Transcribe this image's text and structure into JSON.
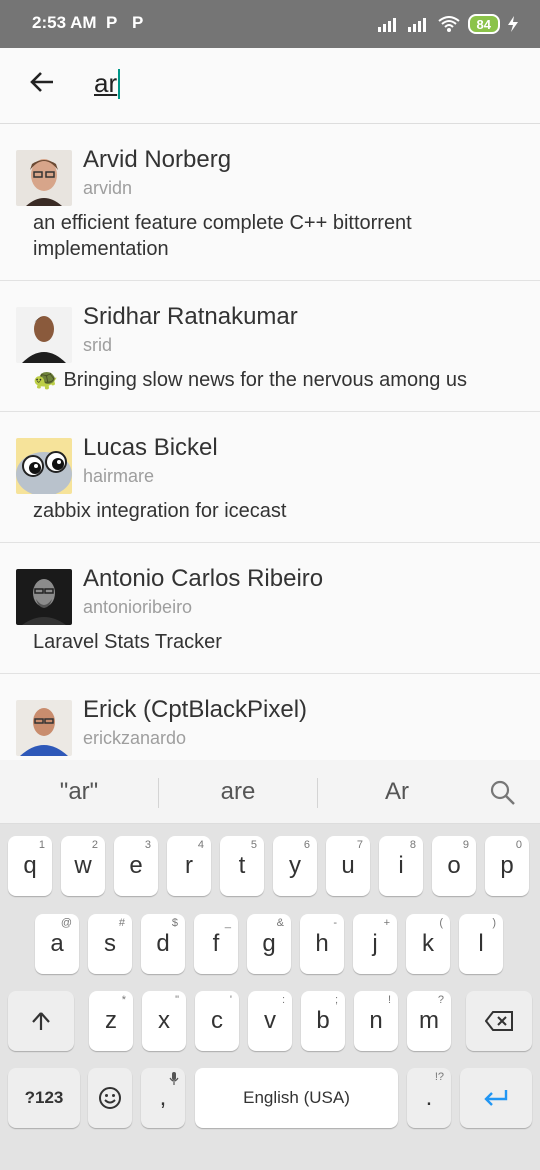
{
  "status": {
    "time": "2:53 AM",
    "p1": "P",
    "p2": "P",
    "battery": "84"
  },
  "search": {
    "query": "ar"
  },
  "results": [
    {
      "name": "Arvid Norberg",
      "login": "arvidn",
      "description": "an efficient feature complete C++ bittorrent implementation",
      "emoji": ""
    },
    {
      "name": "Sridhar Ratnakumar",
      "login": "srid",
      "description": "Bringing slow news for the nervous among us",
      "emoji": "🐢"
    },
    {
      "name": "Lucas Bickel",
      "login": "hairmare",
      "description": "zabbix integration for icecast",
      "emoji": ""
    },
    {
      "name": "Antonio Carlos Ribeiro",
      "login": "antonioribeiro",
      "description": "Laravel Stats Tracker",
      "emoji": ""
    },
    {
      "name": "Erick (CptBlackPixel)",
      "login": "erickzanardo",
      "description": "",
      "emoji": ""
    }
  ],
  "suggestions": [
    "\"ar\"",
    "are",
    "Ar"
  ],
  "keyboard": {
    "row1": [
      {
        "k": "q",
        "h": "1"
      },
      {
        "k": "w",
        "h": "2"
      },
      {
        "k": "e",
        "h": "3"
      },
      {
        "k": "r",
        "h": "4"
      },
      {
        "k": "t",
        "h": "5"
      },
      {
        "k": "y",
        "h": "6"
      },
      {
        "k": "u",
        "h": "7"
      },
      {
        "k": "i",
        "h": "8"
      },
      {
        "k": "o",
        "h": "9"
      },
      {
        "k": "p",
        "h": "0"
      }
    ],
    "row2": [
      {
        "k": "a",
        "h": "@"
      },
      {
        "k": "s",
        "h": "#"
      },
      {
        "k": "d",
        "h": "$"
      },
      {
        "k": "f",
        "h": "_"
      },
      {
        "k": "g",
        "h": "&"
      },
      {
        "k": "h",
        "h": "-"
      },
      {
        "k": "j",
        "h": "+"
      },
      {
        "k": "k",
        "h": "("
      },
      {
        "k": "l",
        "h": ")"
      }
    ],
    "row3": [
      {
        "k": "z",
        "h": "*"
      },
      {
        "k": "x",
        "h": "\""
      },
      {
        "k": "c",
        "h": "'"
      },
      {
        "k": "v",
        "h": ":"
      },
      {
        "k": "b",
        "h": ";"
      },
      {
        "k": "n",
        "h": "!"
      },
      {
        "k": "m",
        "h": "?"
      }
    ],
    "sym_label": "?123",
    "comma": ",",
    "space_label": "English (USA)",
    "period": ".",
    "period_hint": "!?"
  }
}
